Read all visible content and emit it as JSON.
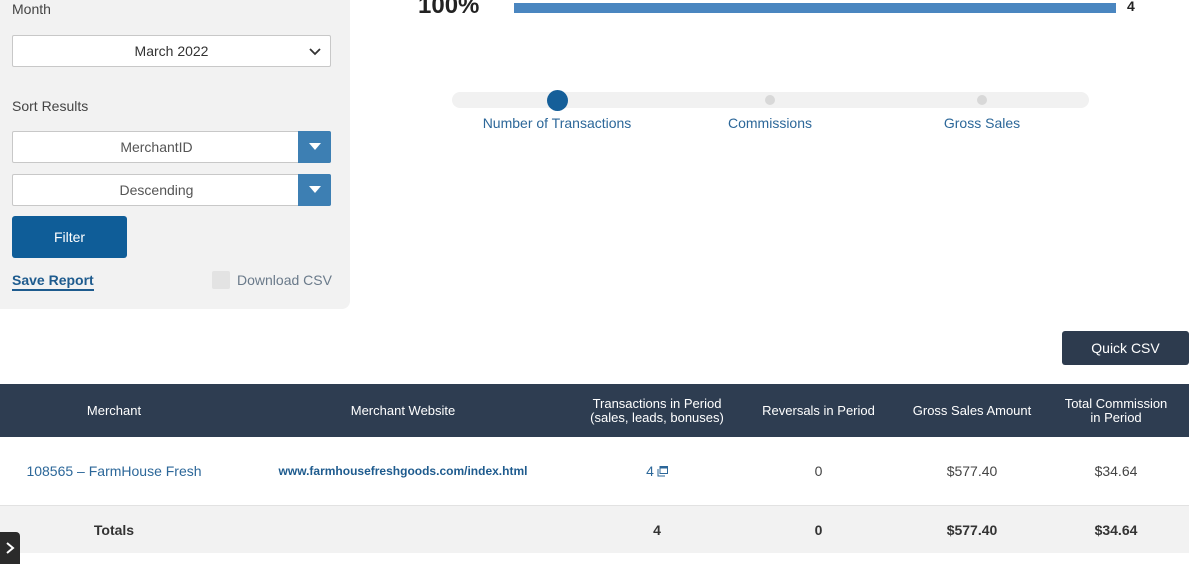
{
  "filters": {
    "month_label": "Month",
    "month_value": "March 2022",
    "sort_label": "Sort Results",
    "sort_field": "MerchantID",
    "sort_order": "Descending",
    "filter_button": "Filter",
    "save_report": "Save Report",
    "download_csv": "Download CSV"
  },
  "progress": {
    "percent_label": "100%",
    "fraction": 1.0,
    "count": "4",
    "bar_color": "#4a86c0"
  },
  "metric_slider": {
    "options": [
      "Number of Transactions",
      "Commissions",
      "Gross Sales"
    ],
    "selected_index": 0
  },
  "quick_csv": "Quick CSV",
  "table": {
    "headers": {
      "merchant": "Merchant",
      "website": "Merchant Website",
      "transactions_1": "Transactions in Period",
      "transactions_2": "(sales, leads, bonuses)",
      "reversals": "Reversals in Period",
      "gross_sales": "Gross Sales Amount",
      "commission_1": "Total Commission",
      "commission_2": "in Period"
    },
    "rows": [
      {
        "merchant": "108565 – FarmHouse Fresh",
        "website": "www.farmhousefreshgoods.com/index.html",
        "transactions": "4",
        "reversals": "0",
        "gross_sales": "$577.40",
        "commission": "$34.64"
      }
    ],
    "totals": {
      "label": "Totals",
      "transactions": "4",
      "reversals": "0",
      "gross_sales": "$577.40",
      "commission": "$34.64"
    }
  },
  "icons": {
    "month_select": "chevron-down-icon",
    "dropdown": "caret-down-icon",
    "transactions_link": "external-window-icon",
    "side_toggle": "chevron-right-icon"
  },
  "colors": {
    "primary": "#0f5d98",
    "header_bg": "#2e3d51",
    "link": "#2c6799"
  }
}
